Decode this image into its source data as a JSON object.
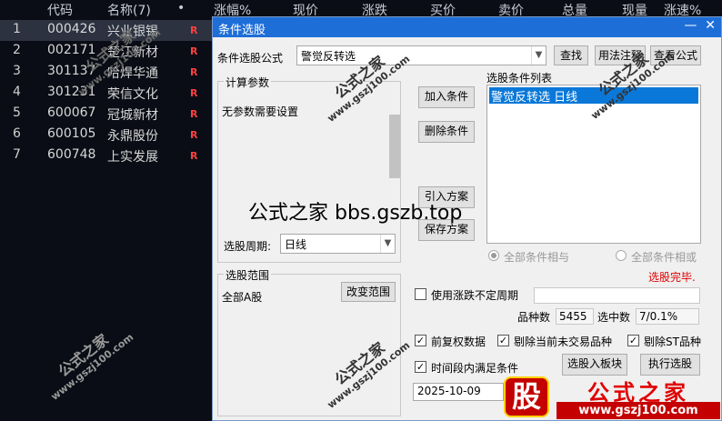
{
  "columns": {
    "code": "代码",
    "name": "名称(7)",
    "dot": "•",
    "change_pct": "涨幅%",
    "price": "现价",
    "change": "涨跌",
    "bid": "买价",
    "ask": "卖价",
    "volume": "总量",
    "cur_vol": "现量",
    "speed": "涨速%"
  },
  "stocks": [
    {
      "n": "1",
      "code": "000426",
      "name": "兴业银锡",
      "flag": "R"
    },
    {
      "n": "2",
      "code": "002171",
      "name": "楚江新材",
      "flag": "R"
    },
    {
      "n": "3",
      "code": "301137",
      "name": "哈焊华通",
      "flag": "R"
    },
    {
      "n": "4",
      "code": "301231",
      "name": "荣信文化",
      "flag": "R"
    },
    {
      "n": "5",
      "code": "600067",
      "name": "冠城新材",
      "flag": "R"
    },
    {
      "n": "6",
      "code": "600105",
      "name": "永鼎股份",
      "flag": "R"
    },
    {
      "n": "7",
      "code": "600748",
      "name": "上实发展",
      "flag": "R"
    }
  ],
  "watermark": {
    "brand": "公式之家",
    "url": "www.gszj100.com"
  },
  "dialog": {
    "title": "条件选股",
    "formula_label": "条件选股公式",
    "formula_value": "警觉反转选",
    "find_btn": "查找",
    "usage_btn": "用法注释",
    "view_btn": "查看公式",
    "params_group": "计算参数",
    "params_text": "无参数需要设置",
    "add_btn": "加入条件",
    "del_btn": "删除条件",
    "import_btn": "引入方案",
    "save_btn": "保存方案",
    "cond_list_label": "选股条件列表",
    "cond_items": [
      "警觉反转选  日线"
    ],
    "period_label": "选股周期:",
    "period_value": "日线",
    "radio_and": "全部条件相与",
    "radio_or": "全部条件相或",
    "status": "选股完毕.",
    "range_group": "选股范围",
    "range_value": "全部A股",
    "change_range_btn": "改变范围",
    "uncertain_label": "使用涨跌不定周期",
    "count_label": "品种数",
    "count_value": "5455",
    "hit_label": "选中数",
    "hit_value": "7/0.1%",
    "chk_prerights": "前复权数据",
    "chk_exclude_untraded": "剔除当前未交易品种",
    "chk_exclude_st": "剔除ST品种",
    "chk_time": "时间段内满足条件",
    "date_value": "2025-10-09",
    "to_board_btn": "选股入板块",
    "run_btn": "执行选股"
  },
  "overlay_text": "公式之家 bbs.gszb.top",
  "logo": {
    "char": "股",
    "text": "公式之家",
    "url": "www.gszj100.com"
  },
  "colors": {
    "title_bar": "#1e6ed8",
    "selection": "#0a78d8",
    "flag": "#ff4040",
    "status": "#e00000"
  }
}
